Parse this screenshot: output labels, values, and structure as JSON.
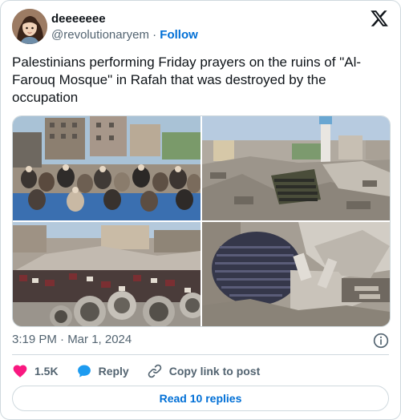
{
  "author": {
    "display_name": "deeeeeee",
    "handle": "@revolutionaryem",
    "separator": "·",
    "follow_label": "Follow"
  },
  "tweet": {
    "text": "Palestinians performing Friday prayers on the ruins of \"Al-Farouq Mosque\" in Rafah that was destroyed by the occupation",
    "timestamp": "3:19 PM · Mar 1, 2024"
  },
  "media": {
    "photos": [
      {
        "name": "photo-worshippers-near-buildings"
      },
      {
        "name": "photo-rubble-with-minaret"
      },
      {
        "name": "photo-crowd-with-concrete-pipes"
      },
      {
        "name": "photo-aerial-prayer-in-ruins"
      }
    ]
  },
  "actions": {
    "like_count": "1.5K",
    "reply_label": "Reply",
    "copy_link_label": "Copy link to post"
  },
  "replies": {
    "read_label": "Read 10 replies"
  },
  "icons": {
    "logo": "x-logo-icon",
    "info": "info-icon",
    "like": "heart-icon",
    "reply": "speech-bubble-icon",
    "copy": "link-icon"
  },
  "colors": {
    "link": "#006fd6",
    "like": "#f91880",
    "reply": "#1d9bf0",
    "muted": "#536471",
    "text": "#0f1419",
    "border": "#cfd9de"
  }
}
